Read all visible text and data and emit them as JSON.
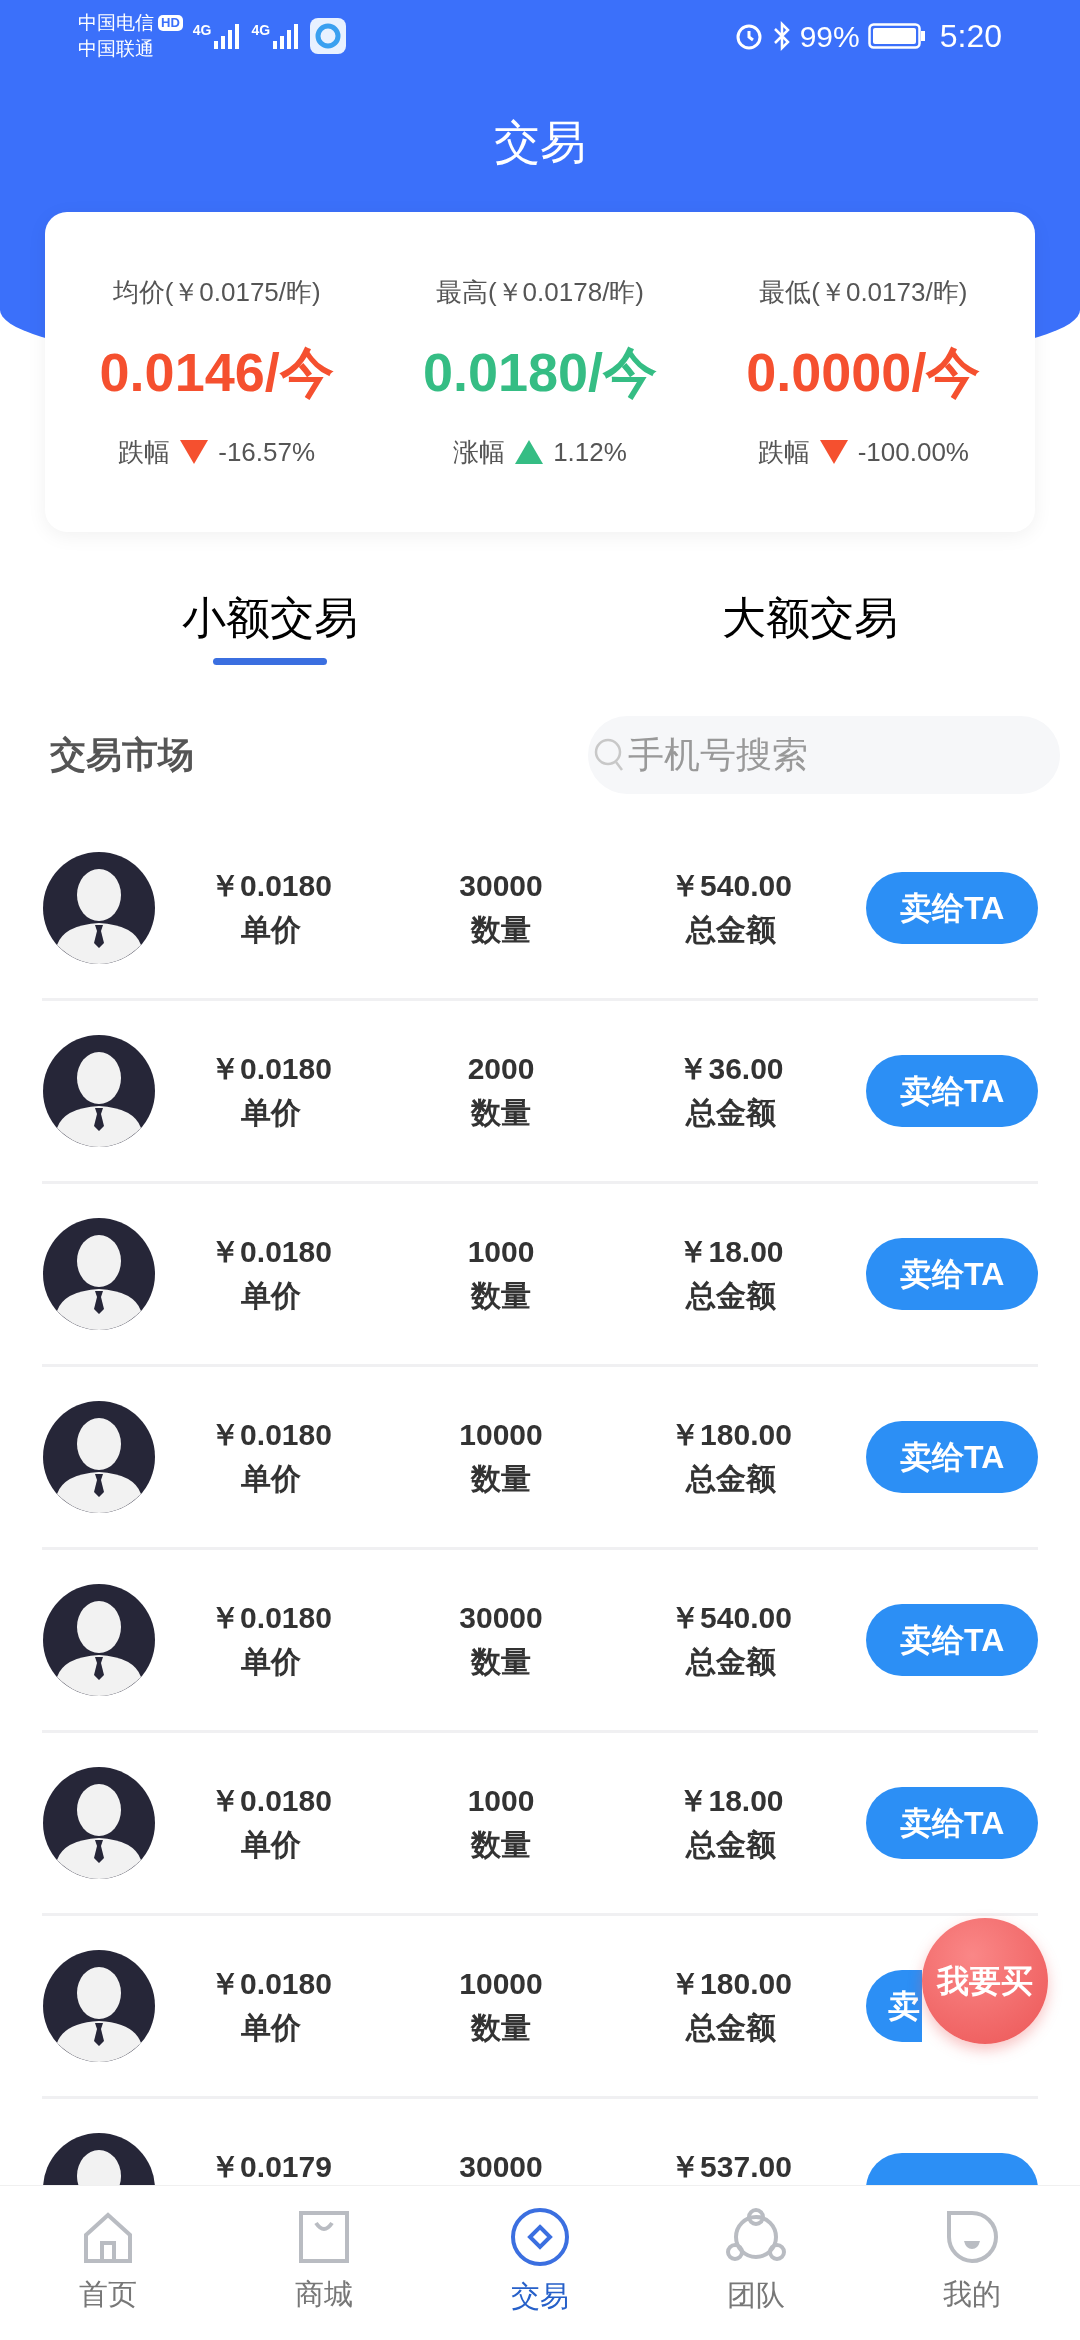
{
  "status_bar": {
    "carriers": [
      "中国电信",
      "中国联通"
    ],
    "hd_badge": "HD",
    "network": [
      "4G",
      "4G"
    ],
    "battery": "99%",
    "time": "5:20"
  },
  "header": {
    "title": "交易"
  },
  "stats": [
    {
      "reference": "均价(￥0.0175/昨)",
      "value": "0.0146/今",
      "trend_label": "跌幅",
      "kind": "fall",
      "change": "-16.57%"
    },
    {
      "reference": "最高(￥0.0178/昨)",
      "value": "0.0180/今",
      "trend_label": "涨幅",
      "kind": "rise",
      "change": "1.12%"
    },
    {
      "reference": "最低(￥0.0173/昨)",
      "value": "0.0000/今",
      "trend_label": "跌幅",
      "kind": "fall",
      "change": "-100.00%"
    }
  ],
  "tabs": [
    {
      "label": "小额交易",
      "selected": true
    },
    {
      "label": "大额交易",
      "selected": false
    }
  ],
  "market": {
    "title": "交易市场",
    "search": {
      "placeholder": "手机号搜索"
    }
  },
  "orders": [
    {
      "price": "￥0.0180",
      "price_label": "单价",
      "quantity": "30000",
      "quantity_label": "数量",
      "total": "￥540.00",
      "total_label": "总金额",
      "button": "卖给TA"
    },
    {
      "price": "￥0.0180",
      "price_label": "单价",
      "quantity": "2000",
      "quantity_label": "数量",
      "total": "￥36.00",
      "total_label": "总金额",
      "button": "卖给TA"
    },
    {
      "price": "￥0.0180",
      "price_label": "单价",
      "quantity": "1000",
      "quantity_label": "数量",
      "total": "￥18.00",
      "total_label": "总金额",
      "button": "卖给TA"
    },
    {
      "price": "￥0.0180",
      "price_label": "单价",
      "quantity": "10000",
      "quantity_label": "数量",
      "total": "￥180.00",
      "total_label": "总金额",
      "button": "卖给TA"
    },
    {
      "price": "￥0.0180",
      "price_label": "单价",
      "quantity": "30000",
      "quantity_label": "数量",
      "total": "￥540.00",
      "total_label": "总金额",
      "button": "卖给TA"
    },
    {
      "price": "￥0.0180",
      "price_label": "单价",
      "quantity": "1000",
      "quantity_label": "数量",
      "total": "￥18.00",
      "total_label": "总金额",
      "button": "卖给TA"
    },
    {
      "price": "￥0.0180",
      "price_label": "单价",
      "quantity": "10000",
      "quantity_label": "数量",
      "total": "￥180.00",
      "total_label": "总金额",
      "button": "卖",
      "kind": "covered"
    },
    {
      "price": "￥0.0179",
      "quantity": "30000",
      "total": "￥537.00"
    }
  ],
  "floating_button": "我要买",
  "nav": [
    {
      "kind": "home",
      "label": "首页",
      "selected": false
    },
    {
      "kind": "shop",
      "label": "商城",
      "selected": false
    },
    {
      "kind": "trade",
      "label": "交易",
      "selected": true
    },
    {
      "kind": "team",
      "label": "团队",
      "selected": false
    },
    {
      "kind": "me",
      "label": "我的",
      "selected": false
    }
  ]
}
